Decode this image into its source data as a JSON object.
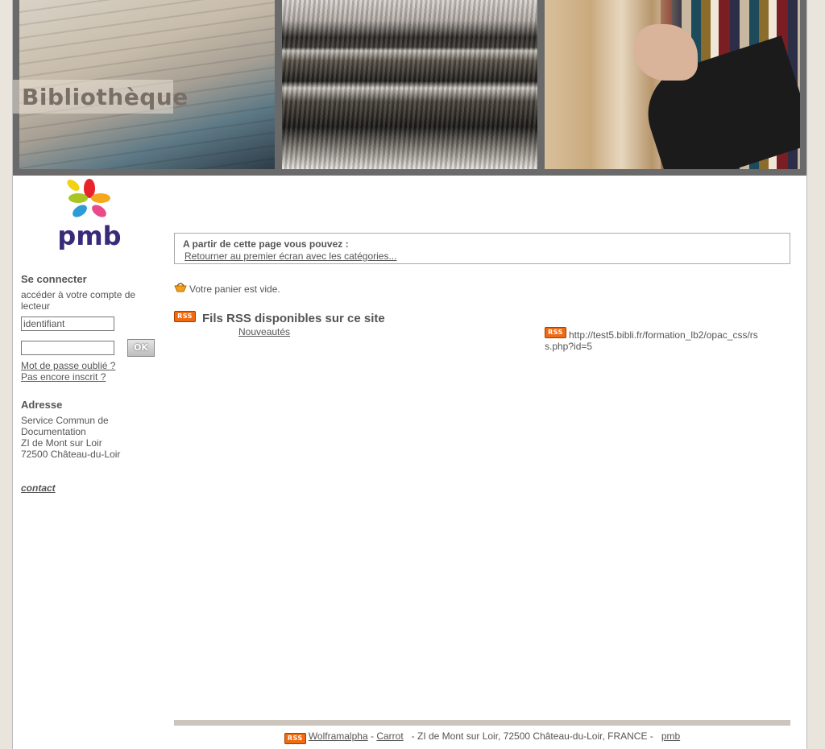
{
  "header": {
    "site_title": "Bibliothèque"
  },
  "sidebar": {
    "login_heading": "Se connecter",
    "login_intro": "accéder à votre compte de lecteur",
    "login_placeholder": "identifiant",
    "ok_label": "OK",
    "forgot_password": "Mot de passe oublié ?",
    "not_registered": "Pas encore inscrit ?",
    "address_heading": "Adresse",
    "address_lines": [
      "Service Commun de",
      "Documentation",
      "ZI de Mont sur Loir",
      "72500 Château-du-Loir"
    ],
    "contact": "contact"
  },
  "main": {
    "nav_title": "A partir de cette page vous pouvez :",
    "nav_link": "Retourner au premier écran avec les catégories...",
    "basket_text": "Votre panier est vide.",
    "rss_heading": "Fils RSS disponibles sur ce site",
    "rss_badge": "RSS",
    "feeds": [
      {
        "name": "Nouveautés",
        "url": "http://test5.bibli.fr/formation_lb2/opac_css/rss.php?id=5"
      }
    ]
  },
  "footer": {
    "link_wolfram": "Wolframalpha",
    "sep": "-",
    "link_carrot": "Carrot",
    "address": "- ZI de Mont sur Loir, 72500 Château-du-Loir, FRANCE -",
    "link_pmb": "pmb"
  },
  "colors": {
    "accent": "#f06a12",
    "text": "#555555",
    "banner_bg": "#6a6a6a",
    "page_bg": "#e9e4dc"
  }
}
